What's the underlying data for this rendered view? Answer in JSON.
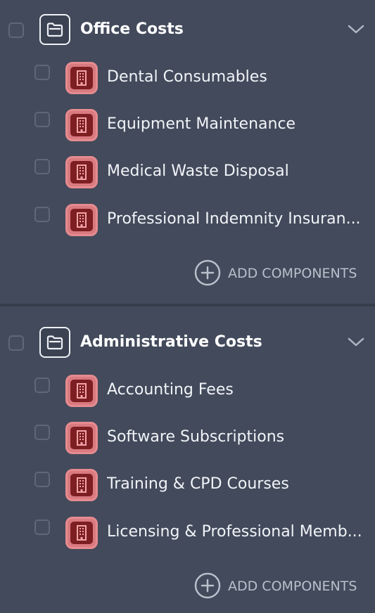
{
  "groups": [
    {
      "title": "Office Costs",
      "items": [
        {
          "label": "Dental Consumables"
        },
        {
          "label": "Equipment Maintenance"
        },
        {
          "label": "Medical Waste Disposal"
        },
        {
          "label": "Professional Indemnity Insuran..."
        }
      ],
      "add_label": "ADD COMPONENTS"
    },
    {
      "title": "Administrative Costs",
      "items": [
        {
          "label": "Accounting Fees"
        },
        {
          "label": "Software Subscriptions"
        },
        {
          "label": "Training & CPD Courses"
        },
        {
          "label": "Licensing & Professional Memb..."
        }
      ],
      "add_label": "ADD COMPONENTS"
    }
  ],
  "icons": {
    "group_icon": "folder-icon",
    "item_icon": "building-icon",
    "expand_icon": "chevron-down-icon",
    "add_icon": "plus-circle-icon"
  },
  "colors": {
    "background": "#424a5b",
    "item_badge": "#d97a80",
    "item_badge_inner": "#7d1f22",
    "text": "#f1f4f8",
    "muted_text": "#b9c0cb"
  }
}
